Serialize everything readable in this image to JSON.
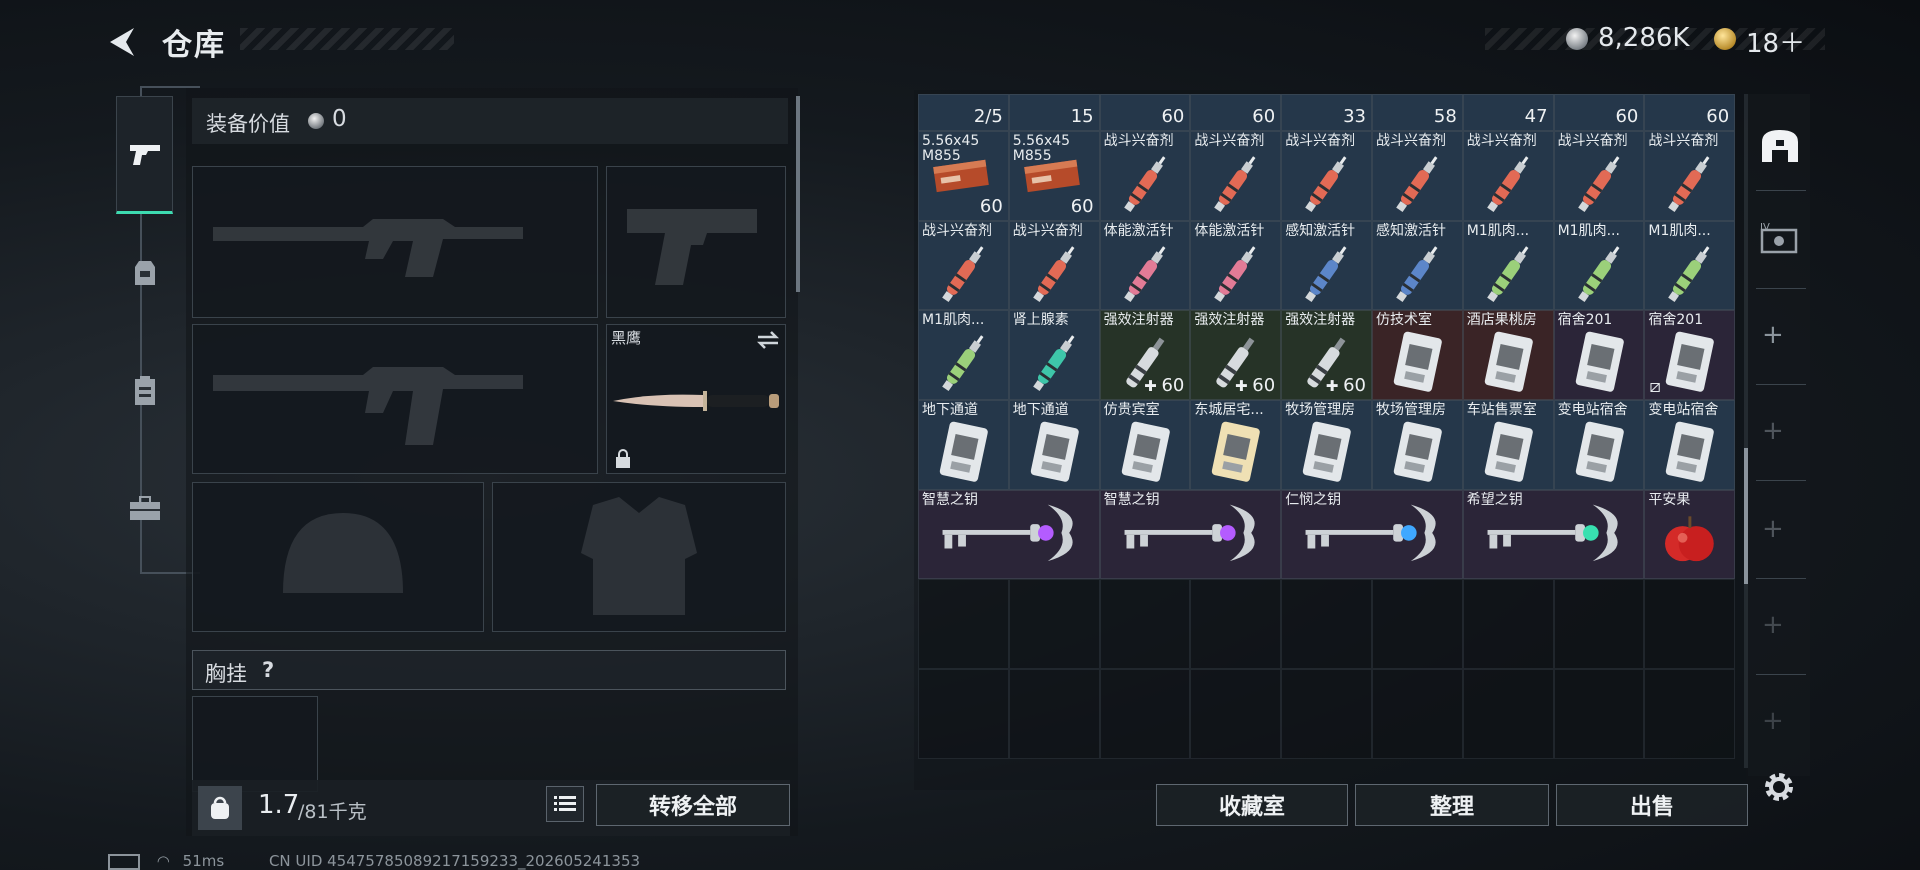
{
  "header": {
    "title": "仓库",
    "currency1": "8,286K",
    "currency2": "18＋"
  },
  "colors": {
    "accent": "#3ddbb0",
    "panel": "#14191e"
  },
  "tabs": [
    {
      "name": "weapon",
      "icon": "pistol-icon",
      "active": true
    },
    {
      "name": "armor",
      "icon": "backpack-icon"
    },
    {
      "name": "inventory",
      "icon": "clipboard-icon"
    },
    {
      "name": "kit",
      "icon": "briefcase-icon"
    }
  ],
  "loadout": {
    "equip_label": "装备价值",
    "equip_value": "0",
    "knife_name": "黑鹰",
    "chest_label": "胸挂",
    "chest_help": "?",
    "weight_current": "1.7",
    "weight_max": "/81千克",
    "transfer_all": "转移全部"
  },
  "storage": {
    "top_counts": [
      "2/5",
      "15",
      "60",
      "60",
      "33",
      "58",
      "47",
      "60",
      "60"
    ],
    "rows": [
      [
        {
          "name": "5.56x45\nM855",
          "count": "60",
          "type": "ammo"
        },
        {
          "name": "5.56x45\nM855",
          "count": "60",
          "type": "ammo"
        },
        {
          "name": "战斗兴奋剂",
          "type": "syringe-red"
        },
        {
          "name": "战斗兴奋剂",
          "type": "syringe-red"
        },
        {
          "name": "战斗兴奋剂",
          "type": "syringe-red"
        },
        {
          "name": "战斗兴奋剂",
          "type": "syringe-red"
        },
        {
          "name": "战斗兴奋剂",
          "type": "syringe-red"
        },
        {
          "name": "战斗兴奋剂",
          "type": "syringe-red"
        },
        {
          "name": "战斗兴奋剂",
          "type": "syringe-red"
        }
      ],
      [
        {
          "name": "战斗兴奋剂",
          "type": "syringe-red"
        },
        {
          "name": "战斗兴奋剂",
          "type": "syringe-red"
        },
        {
          "name": "体能激活针",
          "type": "syringe-pink"
        },
        {
          "name": "体能激活针",
          "type": "syringe-pink"
        },
        {
          "name": "感知激活针",
          "type": "syringe-blue"
        },
        {
          "name": "感知激活针",
          "type": "syringe-blue"
        },
        {
          "name": "M1肌肉...",
          "type": "syringe-green"
        },
        {
          "name": "M1肌肉...",
          "type": "syringe-green"
        },
        {
          "name": "M1肌肉...",
          "type": "syringe-green"
        }
      ],
      [
        {
          "name": "M1肌肉...",
          "type": "syringe-green"
        },
        {
          "name": "肾上腺素",
          "type": "syringe-teal"
        },
        {
          "name": "强效注射器",
          "count": "60",
          "plus": true,
          "type": "injector"
        },
        {
          "name": "强效注射器",
          "count": "60",
          "plus": true,
          "type": "injector"
        },
        {
          "name": "强效注射器",
          "count": "60",
          "plus": true,
          "type": "injector"
        },
        {
          "name": "仿技术室",
          "type": "keycard",
          "bg": "red"
        },
        {
          "name": "酒店果桃房",
          "type": "keycard",
          "bg": "red"
        },
        {
          "name": "宿舍201",
          "type": "keycard",
          "bg": "purple"
        },
        {
          "name": "宿舍201",
          "type": "keycard",
          "bg": "purple",
          "broken": true
        }
      ],
      [
        {
          "name": "地下通道",
          "type": "keycard"
        },
        {
          "name": "地下通道",
          "type": "keycard"
        },
        {
          "name": "仿贵宾室",
          "type": "keycard"
        },
        {
          "name": "东城居宅...",
          "type": "keycard",
          "gold": true
        },
        {
          "name": "牧场管理房",
          "type": "keycard"
        },
        {
          "name": "牧场管理房",
          "type": "keycard"
        },
        {
          "name": "车站售票室",
          "type": "keycard"
        },
        {
          "name": "变电站宿舍",
          "type": "keycard"
        },
        {
          "name": "变电站宿舍",
          "type": "keycard"
        }
      ]
    ],
    "keys": [
      {
        "name": "智慧之钥",
        "gem": "#b45cff"
      },
      {
        "name": "智慧之钥",
        "gem": "#b45cff"
      },
      {
        "name": "仁悯之钥",
        "gem": "#3fa8ff"
      },
      {
        "name": "希望之钥",
        "gem": "#38e0b0"
      }
    ],
    "apple_name": "平安果",
    "collection_btn": "收藏室",
    "sort_btn": "整理",
    "sell_btn": "出售"
  },
  "status": {
    "ping": "51ms",
    "uid": "CN UID 454757850892171592​33_202605241353"
  }
}
